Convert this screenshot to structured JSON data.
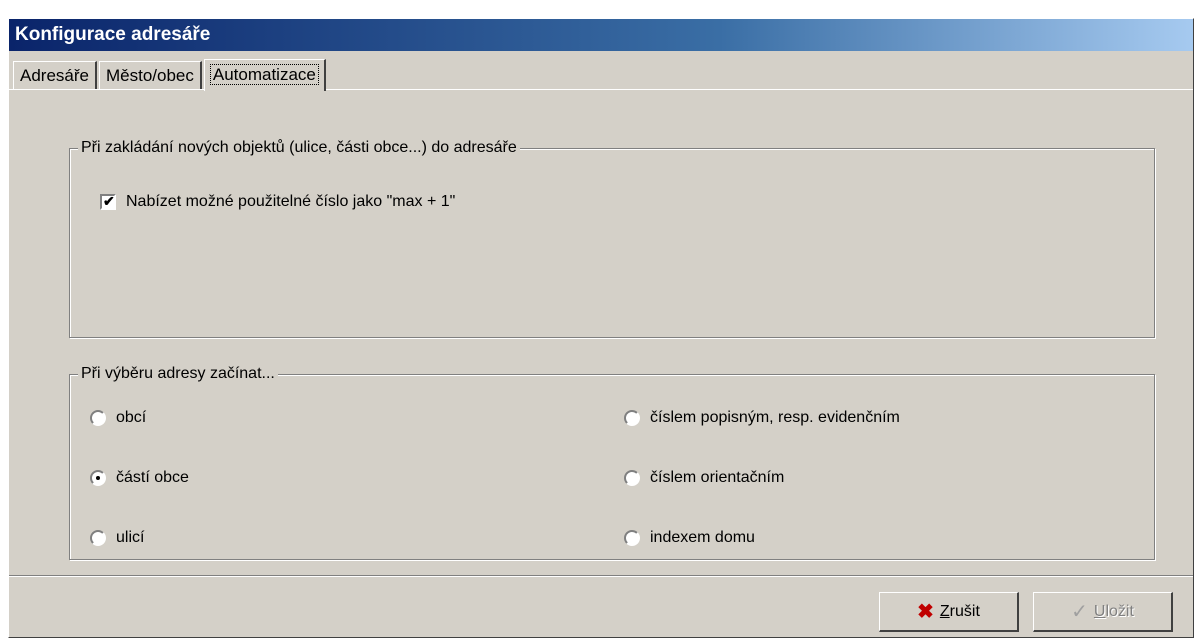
{
  "window": {
    "title": "Konfigurace adresáře"
  },
  "tabs": [
    {
      "label": "Adresáře",
      "active": false
    },
    {
      "label": "Město/obec",
      "active": false
    },
    {
      "label": "Automatizace",
      "active": true
    }
  ],
  "group_new_objects": {
    "legend": "Při zakládání nových objektů (ulice, části obce...) do adresáře",
    "checkbox": {
      "label": "Nabízet možné použitelné číslo jako \"max + 1\"",
      "checked": true
    }
  },
  "group_address_start": {
    "legend": "Při výběru adresy začínat...",
    "options": [
      {
        "label": "obcí",
        "selected": false
      },
      {
        "label": "částí obce",
        "selected": true
      },
      {
        "label": "ulicí",
        "selected": false
      },
      {
        "label": "číslem popisným, resp. evidenčním",
        "selected": false
      },
      {
        "label": "číslem orientačním",
        "selected": false
      },
      {
        "label": "indexem domu",
        "selected": false
      }
    ]
  },
  "buttons": {
    "cancel": {
      "label": "Zrušit",
      "icon": "x-icon",
      "enabled": true
    },
    "save": {
      "label": "Uložit",
      "icon": "checkmark-icon",
      "enabled": false
    }
  }
}
